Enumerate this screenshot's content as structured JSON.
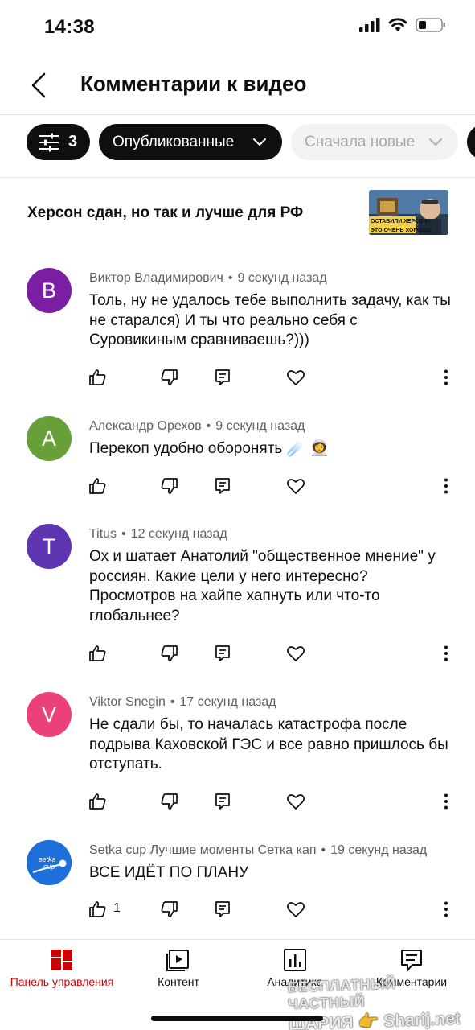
{
  "status_bar": {
    "time": "14:38"
  },
  "header": {
    "title": "Комментарии к видео"
  },
  "filters": {
    "filter_count": "3",
    "published_label": "Опубликованные",
    "sort_label": "Сначала новые"
  },
  "video": {
    "title": "Херсон сдан, но так и лучше для РФ",
    "thumb_text": "ОСТАВИЛИ ХЕРСОН - ЭТО ОЧЕНЬ ХОРОШО"
  },
  "comments": [
    {
      "avatar_letter": "В",
      "avatar_color": "#7b1fa2",
      "author": "Виктор Владимирович",
      "time": "9 секунд назад",
      "text": "Толь, ну не удалось тебе выполнить задачу, как ты не старался) И ты что реально себя с Суровикиным сравниваешь?)))",
      "likes": ""
    },
    {
      "avatar_letter": "А",
      "avatar_color": "#689f38",
      "author": "Александр Орехов",
      "time": "9 секунд назад",
      "text": "Перекоп удобно оборонять ☄️ 👩‍🚀",
      "likes": ""
    },
    {
      "avatar_letter": "T",
      "avatar_color": "#5e35b1",
      "author": "Titus",
      "time": "12 секунд назад",
      "text": "Ох и шатает Анатолий \"общественное мнение\" у россиян. Какие цели у него интересно? Просмотров на хайпе хапнуть или что-то глобальнее?",
      "likes": ""
    },
    {
      "avatar_letter": "V",
      "avatar_color": "#ec407a",
      "author": "Viktor Snegin",
      "time": "17 секунд назад",
      "text": "Не сдали бы, то началась катастрофа после подрыва Каховской ГЭС и все равно пришлось бы отступать.",
      "likes": ""
    },
    {
      "avatar_letter": "setka cup",
      "avatar_color": "#1e6fd9",
      "author": "Setka cup Лучшие моменты Сетка кап",
      "time": "19 секунд назад",
      "text": "ВСЕ ИДЁТ ПО ПЛАНУ",
      "likes": "1"
    }
  ],
  "bottom_nav": [
    {
      "label": "Панель управления",
      "icon": "dashboard-icon"
    },
    {
      "label": "Контент",
      "icon": "content-icon"
    },
    {
      "label": "Аналитика",
      "icon": "analytics-icon"
    },
    {
      "label": "Комментарии",
      "icon": "comments-icon"
    }
  ],
  "watermark": {
    "line1": "БЕСПЛАТНЫЙ ЧАСТНЫЙ",
    "line2": "ШАРИЯ 👉 Sharij.net"
  },
  "colors": {
    "accent": "#cc0000",
    "chip_dark": "#0f0f0f",
    "chip_light": "#f2f2f2"
  }
}
